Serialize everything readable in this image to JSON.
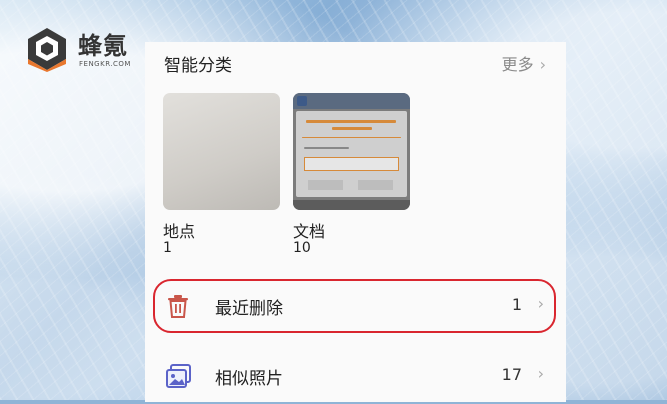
{
  "watermark": {
    "name_cn": "蜂氪",
    "name_en": "FENGKR.COM"
  },
  "smart_categories": {
    "title": "智能分类",
    "more_label": "更多",
    "items": [
      {
        "label": "地点",
        "count": "1"
      },
      {
        "label": "文档",
        "count": "10"
      }
    ]
  },
  "list": {
    "items": [
      {
        "label": "最近删除",
        "count": "1",
        "icon": "trash-icon"
      },
      {
        "label": "相似照片",
        "count": "17",
        "icon": "similar-photos-icon"
      }
    ]
  },
  "colors": {
    "accent_icon": "#c9564a",
    "similar_icon": "#5b63c8",
    "highlight": "#d9262f"
  }
}
